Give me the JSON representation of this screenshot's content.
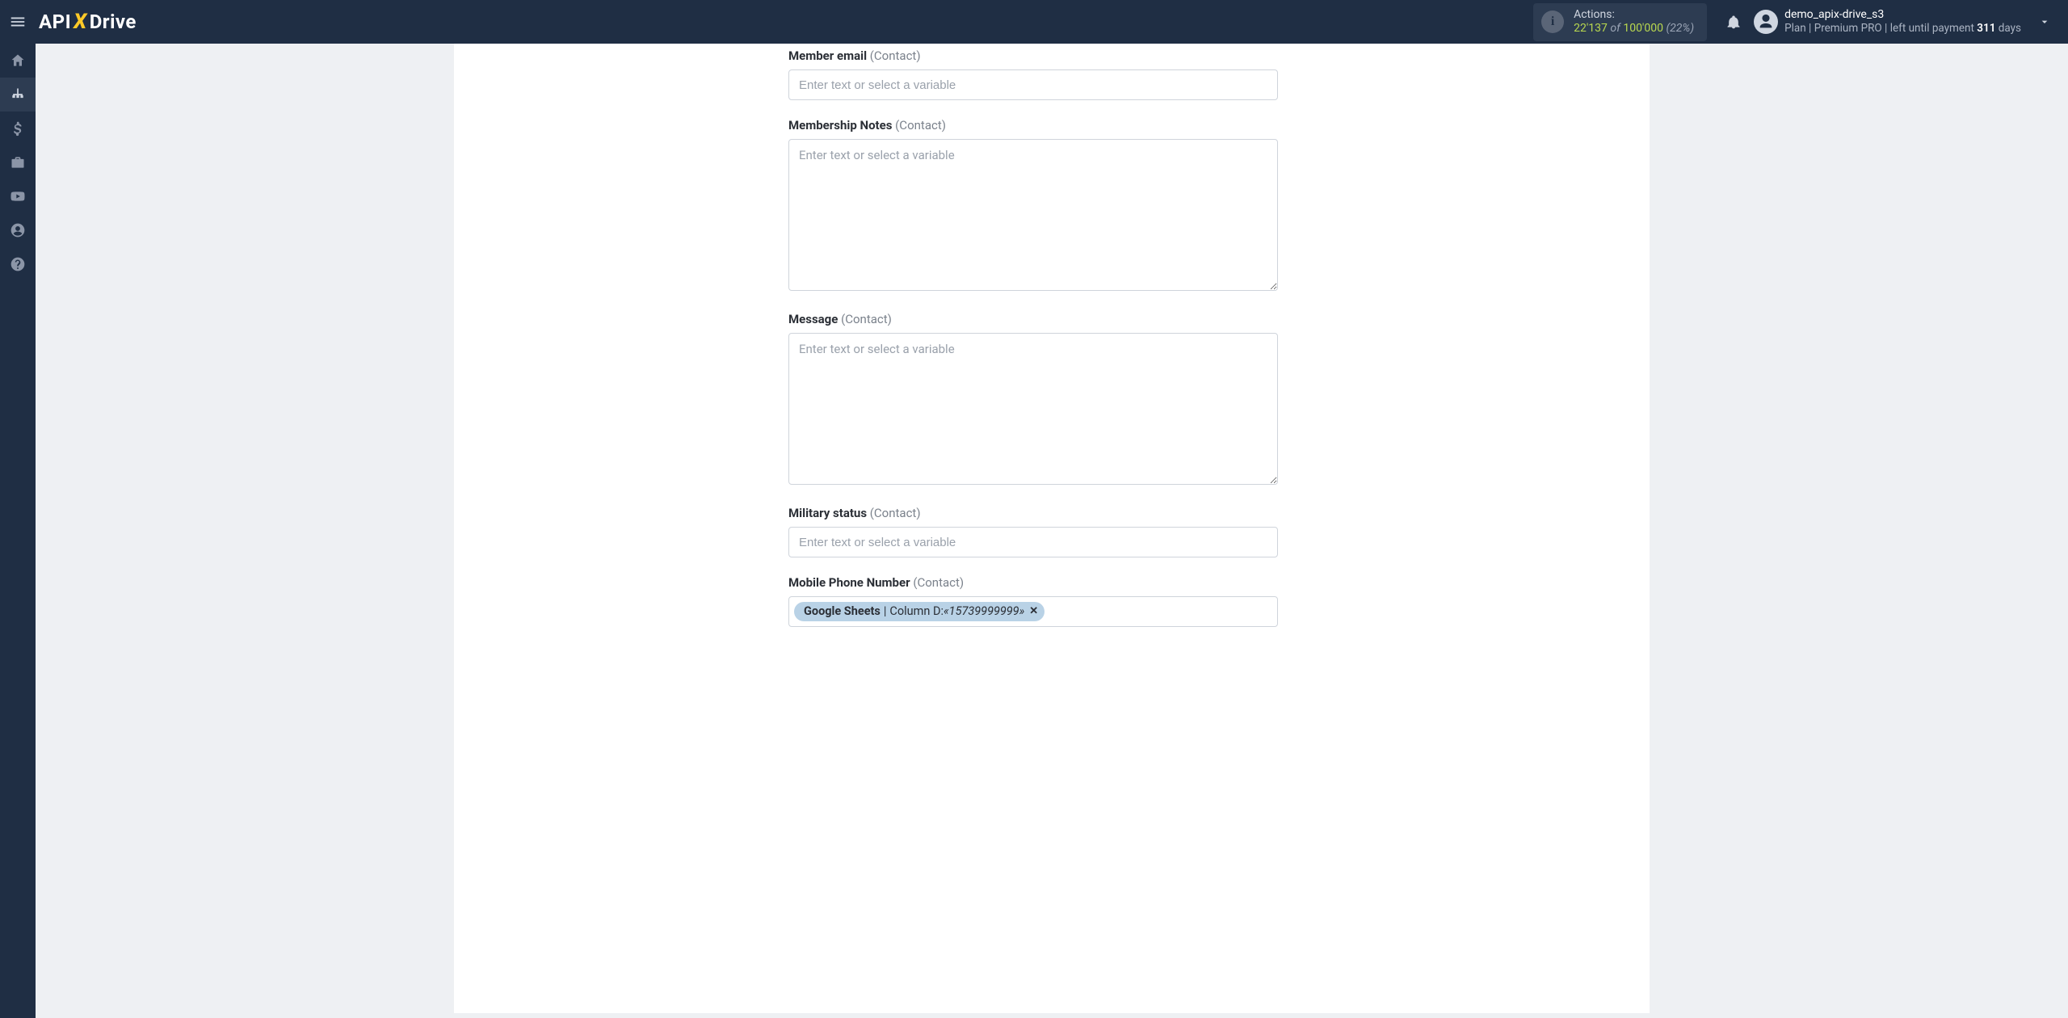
{
  "header": {
    "logo": {
      "left": "API",
      "x": "X",
      "right": "Drive"
    },
    "actions": {
      "label": "Actions:",
      "used": "22'137",
      "of_word": "of",
      "total": "100'000",
      "pct": "(22%)"
    },
    "user": {
      "name": "demo_apix-drive_s3",
      "plan_prefix": "Plan",
      "plan_name": "Premium PRO",
      "left_prefix": "left until payment",
      "days": "311",
      "days_unit": "days"
    }
  },
  "sidebar": {
    "items": [
      {
        "id": "home"
      },
      {
        "id": "connections"
      },
      {
        "id": "billing"
      },
      {
        "id": "briefcase"
      },
      {
        "id": "videos"
      },
      {
        "id": "account"
      },
      {
        "id": "help"
      }
    ]
  },
  "form": {
    "placeholder": "Enter text or select a variable",
    "fields": [
      {
        "name": "Member email",
        "scope": "(Contact)",
        "kind": "text"
      },
      {
        "name": "Membership Notes",
        "scope": "(Contact)",
        "kind": "textarea"
      },
      {
        "name": "Message",
        "scope": "(Contact)",
        "kind": "textarea"
      },
      {
        "name": "Military status",
        "scope": "(Contact)",
        "kind": "text"
      },
      {
        "name": "Mobile Phone Number",
        "scope": "(Contact)",
        "kind": "chip",
        "chip": {
          "source": "Google Sheets",
          "column": "Column D:",
          "value": "«15739999999»"
        }
      }
    ]
  }
}
